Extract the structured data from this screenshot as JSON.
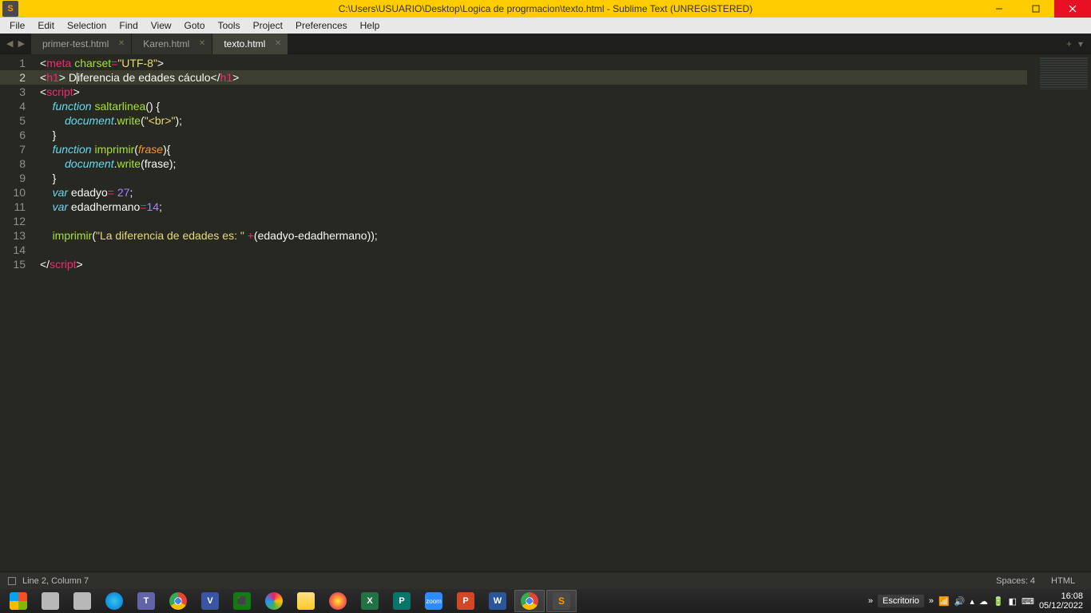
{
  "titlebar": {
    "title": "C:\\Users\\USUARIO\\Desktop\\Logica de progrmacion\\texto.html - Sublime Text (UNREGISTERED)"
  },
  "menu": {
    "items": [
      "File",
      "Edit",
      "Selection",
      "Find",
      "View",
      "Goto",
      "Tools",
      "Project",
      "Preferences",
      "Help"
    ]
  },
  "tabs": {
    "items": [
      {
        "label": "primer-test.html",
        "active": false
      },
      {
        "label": "Karen.html",
        "active": false
      },
      {
        "label": "texto.html",
        "active": true
      }
    ]
  },
  "editor": {
    "line_count": 15,
    "active_line": 2,
    "cursor_col": 7
  },
  "code": {
    "l1": {
      "tag": "meta",
      "attr": "charset",
      "val": "\"UTF-8\""
    },
    "l2": {
      "tag": "h1",
      "text1": " D",
      "text2": "iferencia de edades cáculo"
    },
    "l3": {
      "tag": "script"
    },
    "l4": {
      "kw": "function",
      "name": "saltarlinea"
    },
    "l5": {
      "obj": "document",
      "method": "write",
      "arg": "\"<br>\""
    },
    "l6": {
      "brace": "}"
    },
    "l7": {
      "kw": "function",
      "name": "imprimir",
      "param": "frase"
    },
    "l8": {
      "obj": "document",
      "method": "write",
      "arg": "frase"
    },
    "l9": {
      "brace": "}"
    },
    "l10": {
      "kw": "var",
      "name": "edadyo",
      "op": "=",
      "val": "27"
    },
    "l11": {
      "kw": "var",
      "name": "edadhermano",
      "op": "=",
      "val": "14"
    },
    "l13": {
      "fn": "imprimir",
      "str": "\"La diferencia de edades es: \"",
      "expr": "(edadyo-edadhermano));"
    },
    "l15": {
      "tag": "script"
    }
  },
  "status": {
    "position": "Line 2, Column 7",
    "spaces": "Spaces: 4",
    "syntax": "HTML"
  },
  "taskbar": {
    "desktop_toolbar": "Escritorio",
    "expand": "»",
    "clock": {
      "time": "16:08",
      "date": "05/12/2022"
    },
    "items": [
      {
        "name": "start",
        "color": "#ffffff",
        "accent": "#00a4ef"
      },
      {
        "name": "task-view",
        "color": "#b8b8b8"
      },
      {
        "name": "search",
        "color": "#b8b8b8"
      },
      {
        "name": "edge",
        "color": "#1e88e5"
      },
      {
        "name": "teams",
        "color": "#6264a7"
      },
      {
        "name": "chrome",
        "color": "#ffffff"
      },
      {
        "name": "visio",
        "color": "#3955a3"
      },
      {
        "name": "store",
        "color": "#107c10"
      },
      {
        "name": "photos",
        "color": "#e81e63"
      },
      {
        "name": "explorer",
        "color": "#ffca28"
      },
      {
        "name": "firefox",
        "color": "#ff7139"
      },
      {
        "name": "excel",
        "color": "#217346"
      },
      {
        "name": "publisher",
        "color": "#077568"
      },
      {
        "name": "zoom",
        "color": "#2d8cff"
      },
      {
        "name": "powerpoint",
        "color": "#d24726"
      },
      {
        "name": "word",
        "color": "#2b579a"
      },
      {
        "name": "chrome-open",
        "color": "#ffffff"
      },
      {
        "name": "sublime",
        "color": "#4a4a4a"
      }
    ]
  }
}
